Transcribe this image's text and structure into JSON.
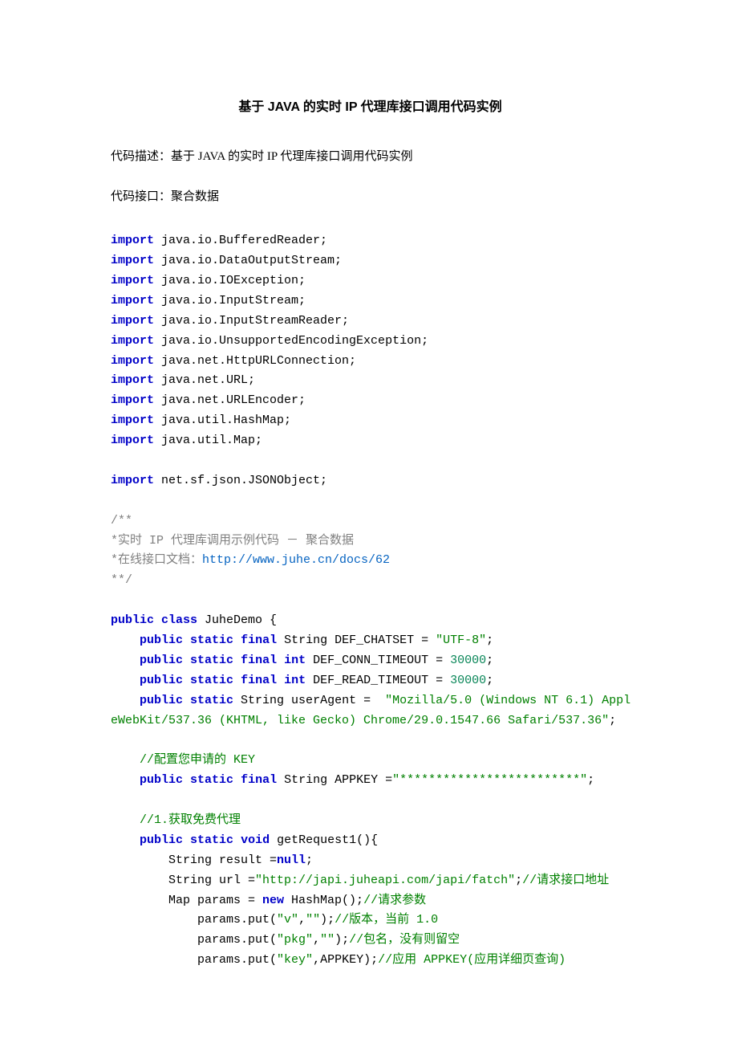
{
  "title": "基于 JAVA 的实时 IP 代理库接口调用代码实例",
  "desc1_label": "代码描述：",
  "desc1_value": "基于 JAVA 的实时 IP 代理库接口调用代码实例",
  "desc2_label": "代码接口：",
  "desc2_value": "聚合数据",
  "code": {
    "import_kw": "import",
    "imp1": " java.io.BufferedReader;",
    "imp2": " java.io.DataOutputStream;",
    "imp3": " java.io.IOException;",
    "imp4": " java.io.InputStream;",
    "imp5": " java.io.InputStreamReader;",
    "imp6": " java.io.UnsupportedEncodingException;",
    "imp7": " java.net.HttpURLConnection;",
    "imp8": " java.net.URL;",
    "imp9": " java.net.URLEncoder;",
    "imp10": " java.util.HashMap;",
    "imp11": " java.util.Map;",
    "imp12": " net.sf.json.JSONObject;",
    "cm_open": "/**",
    "cm_line1": "*实时 IP 代理库调用示例代码 － 聚合数据",
    "cm_line2a": "*在线接口文档：",
    "cm_link": "http://www.juhe.cn/docs/62",
    "cm_close": "**/",
    "public_kw": "public",
    "class_kw": "class",
    "static_kw": "static",
    "final_kw": "final",
    "int_kw": "int",
    "void_kw": "void",
    "new_kw": "new",
    "null_kw": "null",
    "class_name": " JuheDemo {",
    "f1a": " String DEF_CHATSET = ",
    "f1b": "\"UTF-8\"",
    "semi": ";",
    "f2a": " DEF_CONN_TIMEOUT = ",
    "f2b": "30000",
    "f3a": " DEF_READ_TIMEOUT = ",
    "f3b": "30000",
    "f4a": " String userAgent =  ",
    "f4b": "\"Mozilla/5.0 (Windows NT 6.1) Appl",
    "f4c": "eWebKit/537.36 (KHTML, like Gecko) Chrome/29.0.1547.66 Safari/537.36\"",
    "cm_key1": "//配置您申请的 KEY",
    "f5a": " String APPKEY =",
    "f5b": "\"*************************\"",
    "cm_m1": "//1.获取免费代理",
    "m1_sig": " getRequest1(){",
    "m1_l1a": "String result =",
    "m1_l2a": "String url =",
    "m1_l2b": "\"http://japi.juheapi.com/japi/fatch\"",
    "m1_l2c": ";",
    "m1_l2d": "//请求接口地址",
    "m1_l3a": "Map params = ",
    "m1_l3b": " HashMap();",
    "m1_l3c": "//请求参数",
    "m1_p1a": "params.put(",
    "m1_p1b": "\"v\"",
    "m1_p1c": ",",
    "m1_p1d": "\"\"",
    "m1_p1e": ");",
    "m1_p1f": "//版本，当前 1.0",
    "m1_p2b": "\"pkg\"",
    "m1_p2f": "//包名，没有则留空",
    "m1_p3b": "\"key\"",
    "m1_p3d": ",APPKEY);",
    "m1_p3f": "//应用 APPKEY(应用详细页查询)"
  }
}
